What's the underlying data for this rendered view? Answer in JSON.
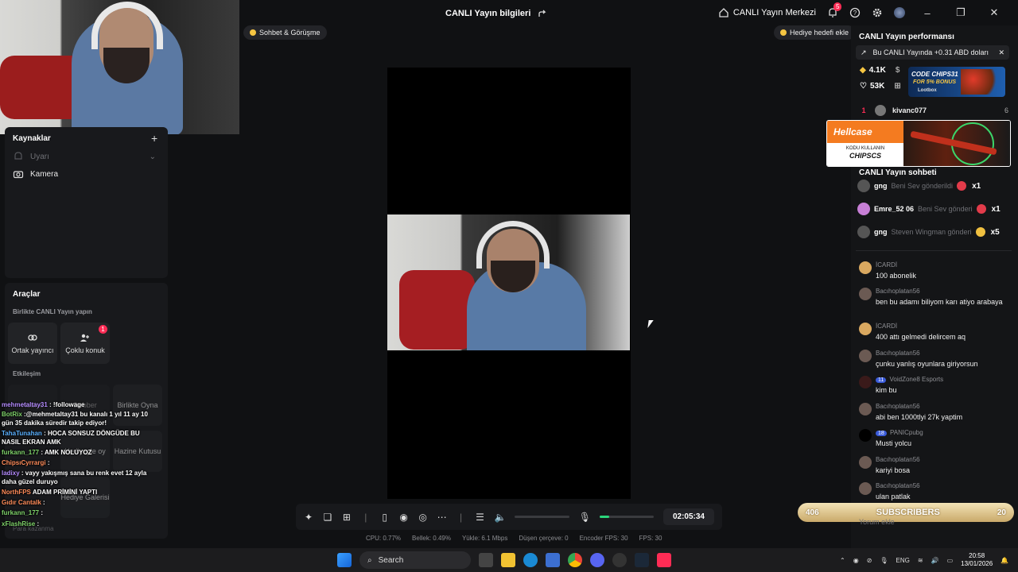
{
  "header": {
    "title": "CANLI Yayın bilgileri",
    "live_center": "CANLI Yayın Merkezi",
    "notif_count": "5"
  },
  "left": {
    "sources_title": "Kaynaklar",
    "sources": [
      {
        "label": "Uyarı",
        "icon": "bell-icon"
      },
      {
        "label": "Kamera",
        "icon": "camera-icon"
      }
    ],
    "tools_title": "Araçlar",
    "together_title": "Birlikte CANLI Yayın yapın",
    "cohost": "Ortak yayıncı",
    "multi_guest": "Çoklu konuk",
    "multi_badge": "1",
    "interaction_title": "Etkileşim",
    "interaction_items": [
      "Hediye",
      "Dobber",
      "Birlikte Oyna",
      "Hediyeyle oy",
      "Hazine Kutusu",
      "Hediye Galerisi",
      "Para kazanma"
    ]
  },
  "overlay_chat": [
    {
      "user": "mehmetaltay31",
      "text": ": !followage"
    },
    {
      "user": "BotRix",
      "text": ":@mehmetaltay31 bu kanalı 1 yıl 11 ay 10 gün 35 dakika süredir takip ediyor!"
    },
    {
      "user": "TahaTunahan",
      "text": ": HOCA SONSUZ DÖNGÜDE BU NASIL EKRAN AMK"
    },
    {
      "user": "furkann_177",
      "text": ": AMK NOLUYOZ"
    },
    {
      "user": "ChipsıCyrrargi",
      "text": ":"
    },
    {
      "user": "ladixy",
      "text": ": vayy yakışmış sana bu renk evet 12 ayla daha güzel duruyo"
    },
    {
      "user": "NorthFPS",
      "text": "ADAM PRİMİNİ YAPTI"
    },
    {
      "user": "Gıdır Cantalk",
      "text": ":"
    },
    {
      "user": "furkann_177",
      "text": ":"
    },
    {
      "user": "xFlashRise",
      "text": ":"
    }
  ],
  "center": {
    "chat_pill": "Sohbet & Görüşme",
    "gift_goal": "Hediye hedefi ekle",
    "timer": "02:05:34",
    "mic_level": 0.18,
    "stats": [
      "CPU: 0.77%",
      "Bellek: 0.49%",
      "Yükle: 6.1 Mbps",
      "Düşen çerçeve: 0",
      "Encoder FPS: 30",
      "FPS: 30"
    ]
  },
  "right": {
    "perf_title": "CANLI Yayın performansı",
    "earnings": "Bu CANLI Yayında +0.31 ABD doları",
    "diamonds": "4.1K",
    "likes": "53K",
    "promo1_code": "CODE CHIPS31",
    "promo1_bonus": "FOR 5% BONUS",
    "promo1_brand": "Lootbox",
    "rank_num": "1",
    "rank_user": "kivanc077",
    "rank_count": "6",
    "promo2_brand": "Hellcase",
    "promo2_label": "KODU KULLANIN",
    "promo2_code": "CHIPSCS",
    "chat_title": "CANLI Yayın sohbeti",
    "gifts": [
      {
        "user": "gng",
        "text": "Beni Sev gönderildi",
        "count": "x1"
      },
      {
        "user": "Emre_52 06",
        "text": "Beni Sev gönderi",
        "count": "x1"
      },
      {
        "user": "gng",
        "text": "Steven Wingman gönderi",
        "count": "x5"
      }
    ],
    "messages": [
      {
        "user": "İCARDİ",
        "text": "100 abonelik"
      },
      {
        "user": "Bacıhoplatan56",
        "text": "ben bu adamı biliyom karı atiyo arabaya"
      },
      {
        "user": "İCARDİ",
        "text": "400 attı gelmedi delircem aq"
      },
      {
        "user": "Bacıhoplatan56",
        "text": "çunku yanlış oyunlara giriyorsun"
      },
      {
        "user": "VoidZone8 Esports",
        "text": "kim bu",
        "level": "11"
      },
      {
        "user": "Bacıhoplatan56",
        "text": "abi ben 1000tlyi 27k yaptim"
      },
      {
        "user": "PANICpubg",
        "text": "Musti yolcu",
        "level": "18"
      },
      {
        "user": "Bacıhoplatan56",
        "text": "kariyi bosa"
      },
      {
        "user": "Bacıhoplatan56",
        "text": "ulan patlak"
      }
    ],
    "subs_left": "406",
    "subs_label": "SUBSCRIBERS",
    "subs_right": "20",
    "comment_placeholder": "Yorum ekle"
  },
  "taskbar": {
    "search": "Search",
    "lang": "ENG",
    "time": "20:58",
    "date": "13/01/2026"
  }
}
